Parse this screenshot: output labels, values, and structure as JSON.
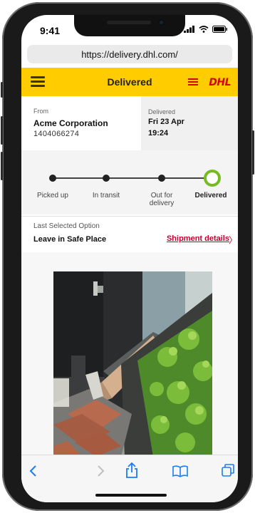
{
  "status_bar": {
    "time": "9:41"
  },
  "browser": {
    "url": "https://delivery.dhl.com/"
  },
  "header": {
    "title": "Delivered",
    "logo_text": "DHL"
  },
  "shipment": {
    "from_label": "From",
    "sender": "Acme Corporation",
    "tracking_number": "1404066274",
    "delivered_label": "Delivered",
    "delivered_date": "Fri 23 Apr",
    "delivered_time": "19:24"
  },
  "progress": {
    "steps": [
      "Picked up",
      "In transit",
      "Out for delivery",
      "Delivered"
    ],
    "current_index": 3
  },
  "option": {
    "label": "Last Selected Option",
    "value": "Leave in Safe Place",
    "details_link": "Shipment details",
    "details_chevron": "〉"
  },
  "toolbar": {
    "icons": [
      "back-icon",
      "forward-icon",
      "share-icon",
      "bookmarks-icon",
      "tabs-icon"
    ]
  },
  "colors": {
    "brand_yellow": "#ffcc00",
    "brand_red": "#d40511",
    "success_green": "#76bc21"
  }
}
